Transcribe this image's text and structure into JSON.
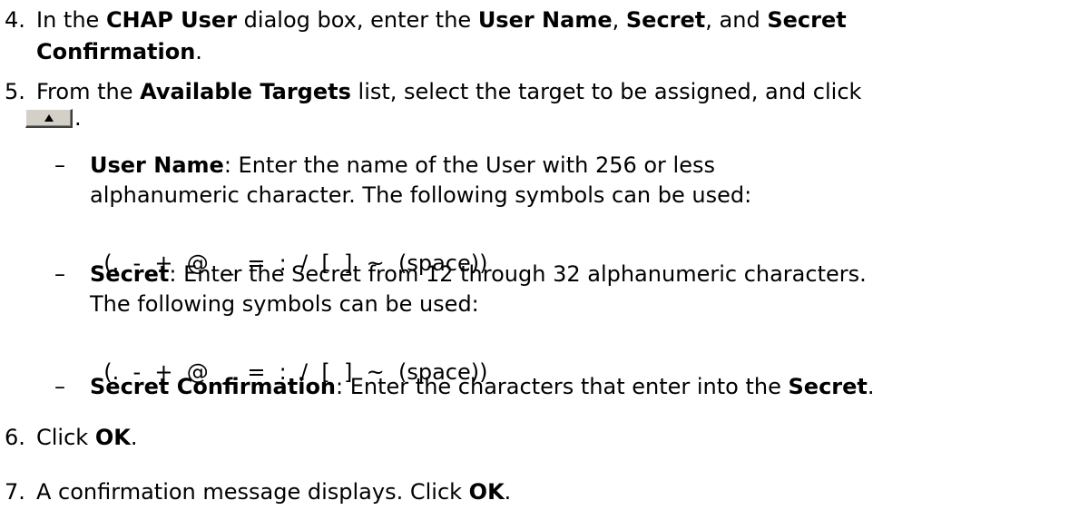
{
  "step4": {
    "number": "4.",
    "t1": "In the ",
    "b1": "CHAP User",
    "t2": " dialog box, enter the ",
    "b2": "User Name",
    "t3": ", ",
    "b3": "Secret",
    "t4": ", and ",
    "b4a": "Secret",
    "b4b": "Confirmation",
    "t5": "."
  },
  "step5": {
    "number": "5.",
    "t1": "From the ",
    "b1": "Available Targets",
    "t2": " list, select the target to be assigned, and click",
    "period": ".",
    "button_icon": "up-arrow-icon"
  },
  "bullets": [
    {
      "dash": "–",
      "label": "User Name",
      "line1": ": Enter the name of the User with 256 or less",
      "line2": "alphanumeric character. The following symbols can be used:",
      "symbols": "(.  -  +  @  _  =  :  /  [  ]  ~  (space))"
    },
    {
      "dash": "–",
      "label": "Secret",
      "line1": ": Enter the Secret from 12 through 32 alphanumeric characters.",
      "line2": "The following symbols can be used:",
      "symbols": "(.  -  +  @  _  =  :  /  [  ]  ~  (space))"
    },
    {
      "dash": "–",
      "label": "Secret Confirmation",
      "line1": ": Enter the characters that enter into the ",
      "label2": "Secret",
      "end": "."
    }
  ],
  "step6": {
    "number": "6.",
    "t1": "Click ",
    "b1": "OK",
    "t2": "."
  },
  "step7": {
    "number": "7.",
    "t1": "A confirmation message displays. Click ",
    "b1": "OK",
    "t2": "."
  }
}
